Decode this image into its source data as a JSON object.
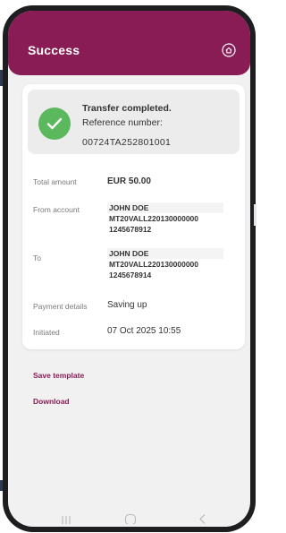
{
  "header": {
    "title": "Success",
    "home_icon": "home-icon",
    "color": "#8a1c55"
  },
  "status": {
    "icon": "check-icon",
    "icon_color": "#5cb85c",
    "title": "Transfer completed.",
    "reference_label": "Reference number:",
    "reference_value": "00724TA252801001"
  },
  "details": {
    "total_amount": {
      "label": "Total amount",
      "value": "EUR 50.00"
    },
    "from_account": {
      "label": "From account",
      "name": "JOHN DOE",
      "iban_line1": "MT20VALL220130000000",
      "iban_line2": "1245678912"
    },
    "to": {
      "label": "To",
      "name": "JOHN DOE",
      "iban_line1": "MT20VALL220130000000",
      "iban_line2": "1245678914"
    },
    "payment_details": {
      "label": "Payment details",
      "value": "Saving up"
    },
    "initiated": {
      "label": "Initiated",
      "value": "07 Oct 2025 10:55"
    }
  },
  "actions": {
    "save_template": "Save template",
    "download": "Download"
  },
  "system_nav": {
    "recents_icon": "recents-icon",
    "home_icon": "nav-home-icon",
    "back_icon": "back-icon"
  }
}
